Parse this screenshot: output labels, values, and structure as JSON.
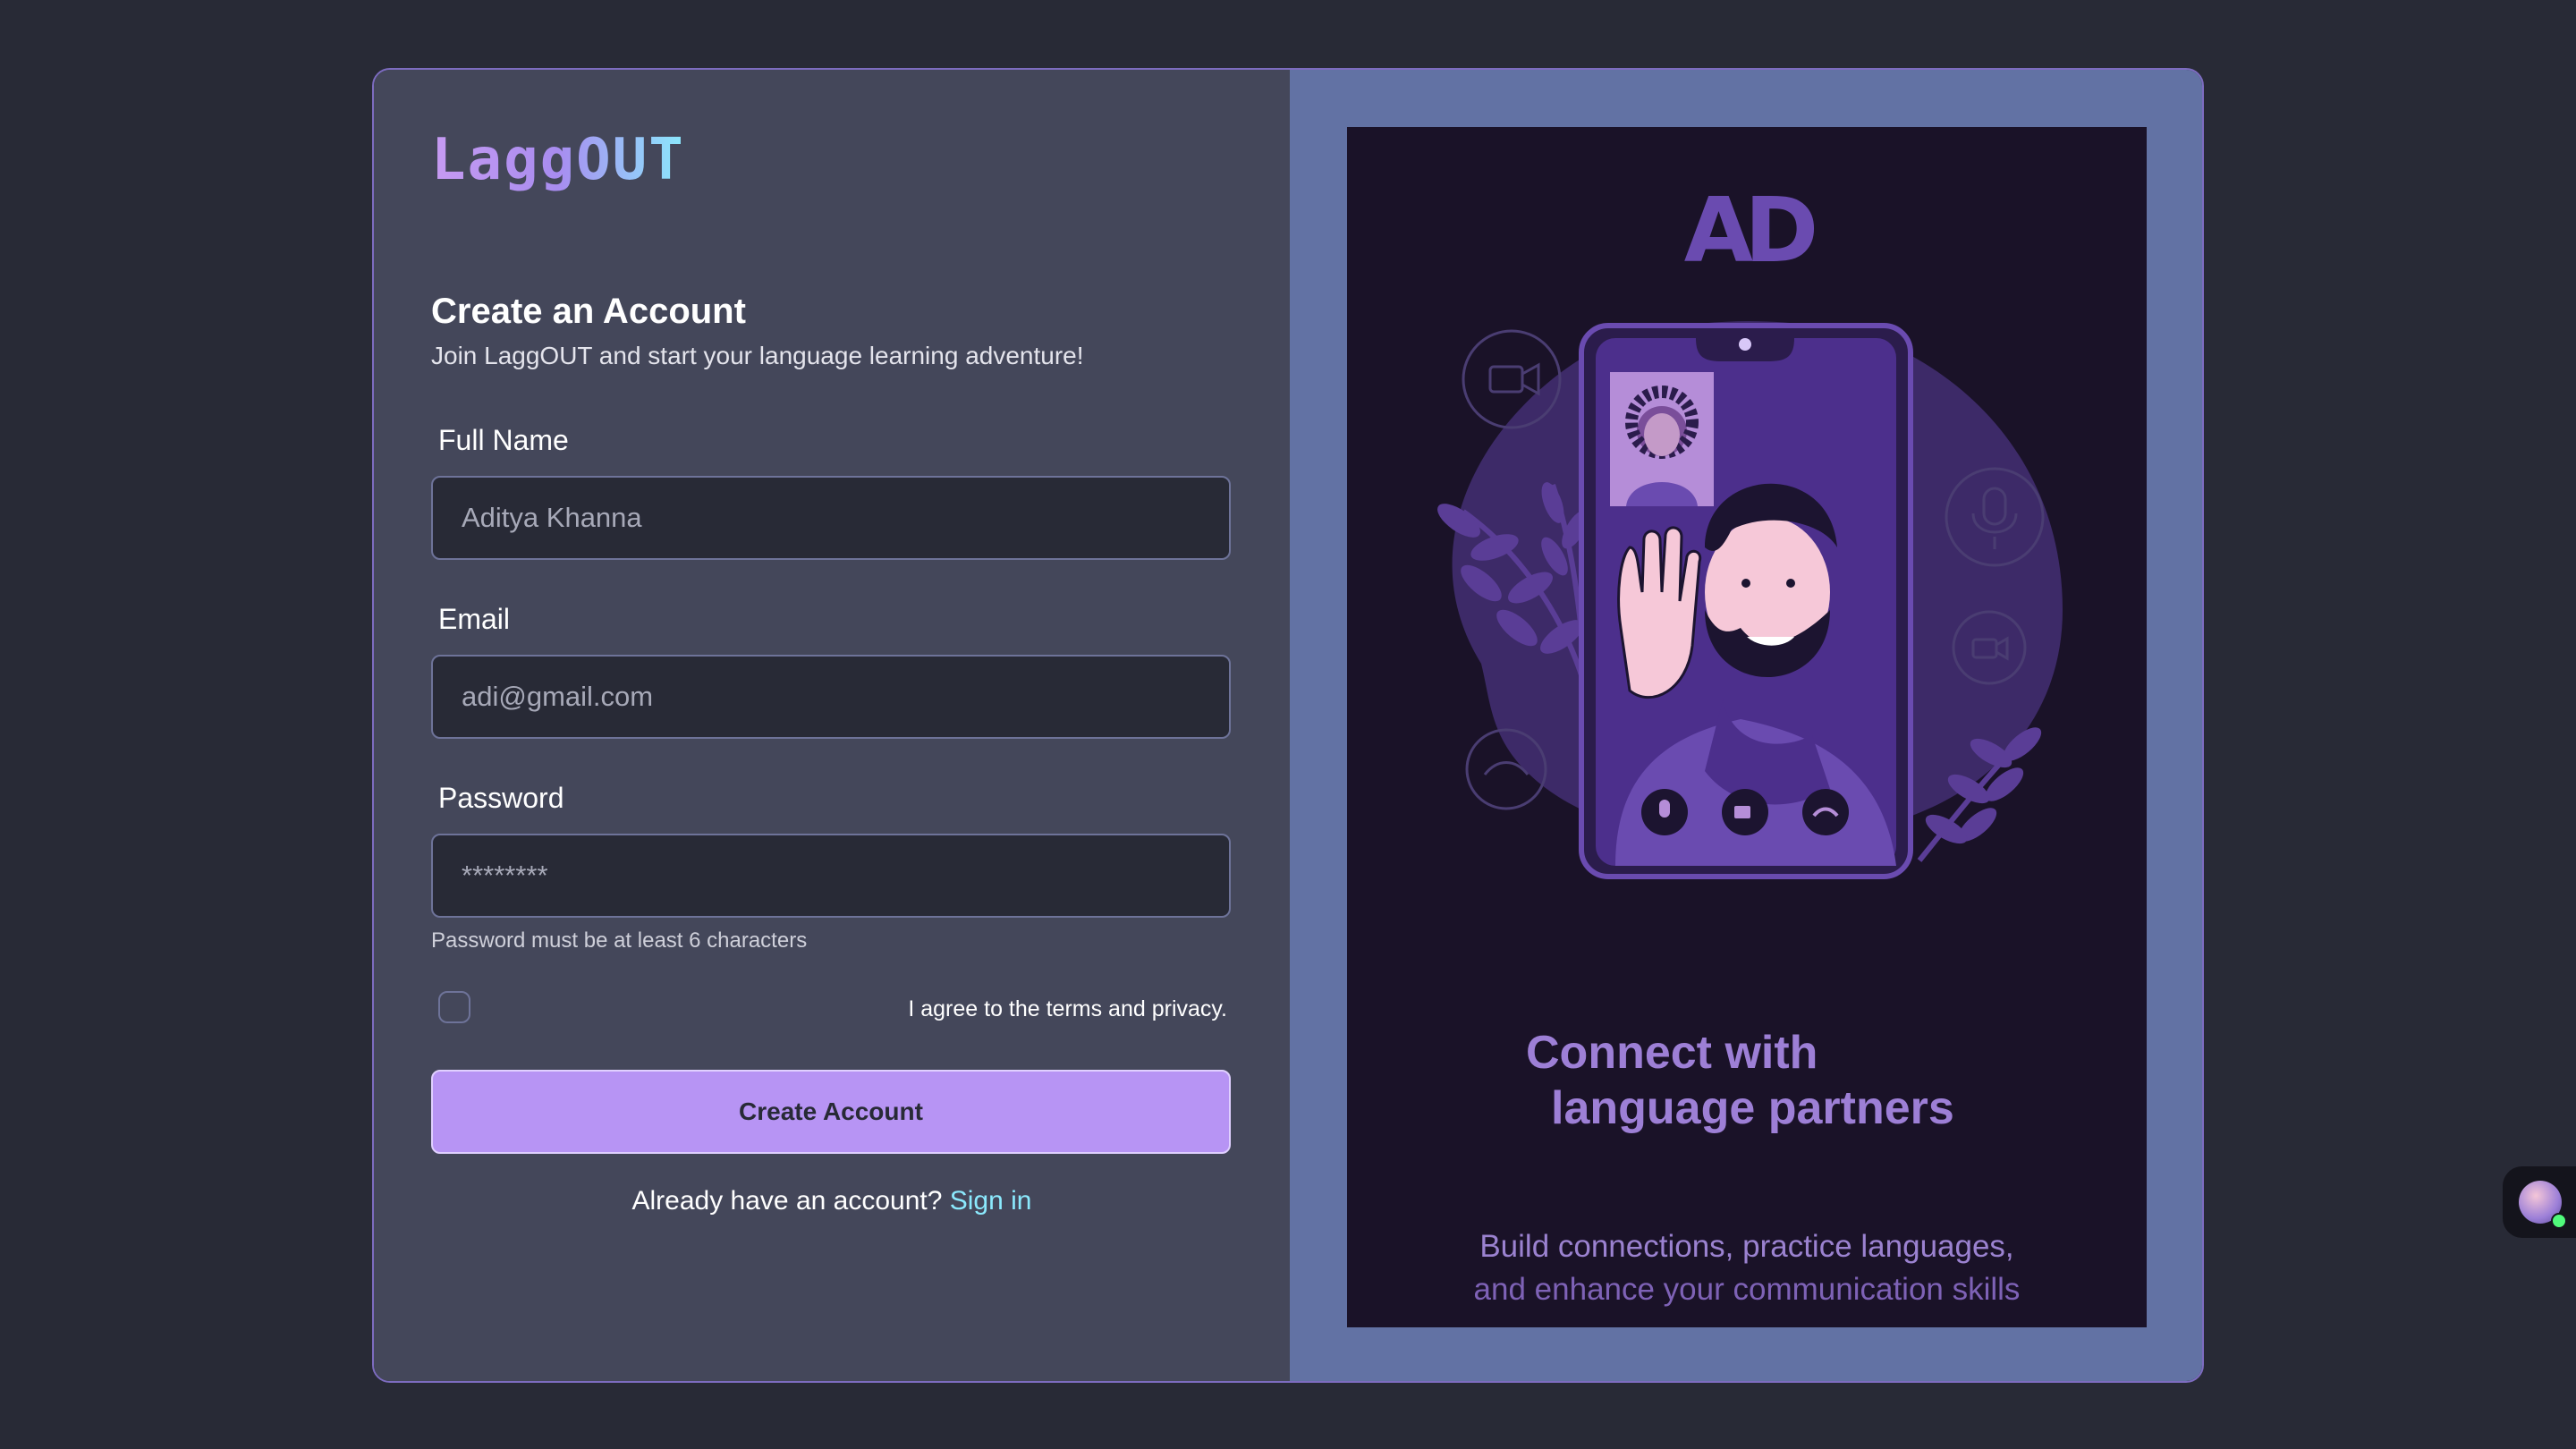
{
  "brand": {
    "name": "LaggOUT"
  },
  "form": {
    "title": "Create an Account",
    "subtitle": "Join LaggOUT and start your language learning adventure!",
    "full_name": {
      "label": "Full Name",
      "placeholder": "Aditya Khanna"
    },
    "email": {
      "label": "Email",
      "placeholder": "adi@gmail.com"
    },
    "password": {
      "label": "Password",
      "placeholder": "********",
      "hint": "Password must be at least 6 characters"
    },
    "terms": {
      "label": "I agree to the terms and privacy.",
      "checked": false
    },
    "submit_label": "Create Account",
    "signin_prompt": "Already have an account?",
    "signin_link": "Sign in"
  },
  "illustration": {
    "logo_text": "AD",
    "heading_line1": "Connect with",
    "heading_line2": "language partners",
    "sub_line1": "Build connections, practice languages,",
    "sub_line2": "and enhance your communication skills",
    "icons": [
      "video-camera-icon",
      "microphone-icon",
      "phone-hangup-icon",
      "mic-button-icon",
      "video-button-icon"
    ]
  },
  "colors": {
    "page_bg": "#282a36",
    "panel_bg": "#44475a",
    "accent": "#b794f4",
    "link": "#8be9fd",
    "illustration_bg": "#1a1228",
    "right_panel_bg": "#6272a4"
  }
}
